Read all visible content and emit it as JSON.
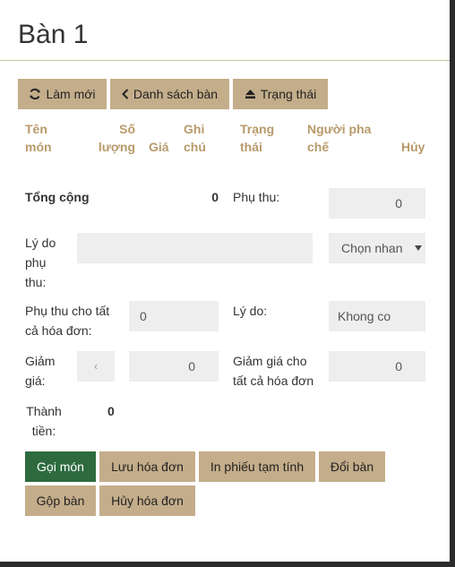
{
  "header": {
    "title": "Bàn 1"
  },
  "toolbar": {
    "refresh": "Làm mới",
    "tables": "Danh sách bàn",
    "status": "Trạng thái"
  },
  "table_headers": {
    "name": "Tên món",
    "qty": "Số lượng",
    "price": "Giá",
    "note": "Ghi chú",
    "state": "Trạng thái",
    "barista": "Người pha chế",
    "cancel": "Hủy"
  },
  "summary": {
    "total_label": "Tổng cộng",
    "total_value": "0",
    "surcharge_label": "Phụ thu:",
    "surcharge_value": "0",
    "surcharge_reason_label": "Lý do phụ thu:",
    "surcharge_reason_value": "",
    "select_placeholder": "Chọn nhan",
    "surcharge_all_label": "Phụ thu cho tất cả hóa đơn:",
    "surcharge_all_value": "0",
    "reason_label": "Lý do:",
    "reason_value": "Khong co",
    "discount_label": "Giảm giá:",
    "discount_small": "‹",
    "discount_value": "0",
    "discount_all_label": "Giảm giá cho tất cả hóa đơn",
    "discount_all_value": "0",
    "final_label": "Thành tiền:",
    "final_value": "0"
  },
  "actions": {
    "order": "Gọi món",
    "save": "Lưu hóa đơn",
    "print": "In phiếu tạm tính",
    "change": "Đổi bàn",
    "merge": "Gộp bàn",
    "cancel_bill": "Hủy hóa đơn"
  }
}
